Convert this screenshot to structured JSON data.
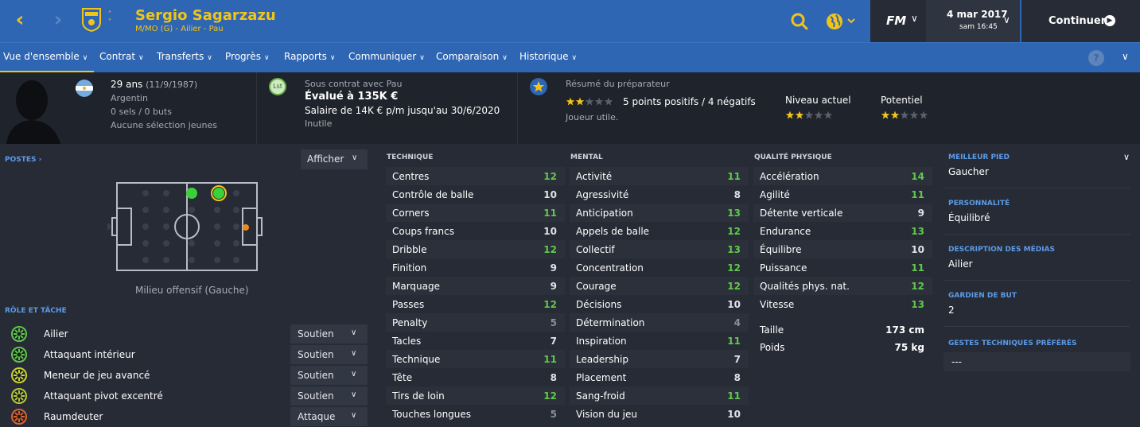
{
  "header": {
    "player_name": "Sergio Sagarzazu",
    "player_subtitle": "M/MO (G) - Ailier - Pau",
    "fm_logo": "FM",
    "date": "4 mar 2017",
    "time": "sam 16:45",
    "continue_label": "Continuer"
  },
  "nav": {
    "tabs": [
      {
        "label": "Vue d'ensemble"
      },
      {
        "label": "Contrat"
      },
      {
        "label": "Transferts"
      },
      {
        "label": "Progrès"
      },
      {
        "label": "Rapports"
      },
      {
        "label": "Communiquer"
      },
      {
        "label": "Comparaison"
      },
      {
        "label": "Historique"
      }
    ],
    "help_label": "?"
  },
  "info": {
    "age": "29 ans",
    "birth": "(11/9/1987)",
    "nationality": "Argentin",
    "caps": "0 sels / 0 buts",
    "youth_caps": "Aucune sélection jeunes",
    "contract_badge": "Lst",
    "contract_with": "Sous contrat avec Pau",
    "value": "Évalué à 135K €",
    "wage": "Salaire de 14K € p/m jusqu'au 30/6/2020",
    "squad_status": "Inutile",
    "scout_title": "Résumé du préparateur",
    "scout_summary": "5 points positifs / 4 négatifs",
    "scout_note": "Joueur utile.",
    "scout_stars": 2,
    "current_label": "Niveau actuel",
    "current_stars": 2,
    "potential_label": "Potentiel",
    "potential_stars": 2,
    "star_total": 5
  },
  "colors": {
    "header_blue": "#2f66b3",
    "accent_yellow": "#f0c419",
    "attr_high": "#5fc94b",
    "label_blue": "#5d9be8"
  },
  "positions": {
    "title": "POSTES",
    "show_label": "Afficher",
    "caption": "Milieu offensif (Gauche)"
  },
  "roles": {
    "title": "RÔLE ET TÂCHE",
    "items": [
      {
        "name": "Ailier",
        "duty": "Soutien",
        "color": "#5fc94b"
      },
      {
        "name": "Attaquant intérieur",
        "duty": "Soutien",
        "color": "#5fc94b"
      },
      {
        "name": "Meneur de jeu avancé",
        "duty": "Soutien",
        "color": "#c9d42d"
      },
      {
        "name": "Attaquant pivot excentré",
        "duty": "Soutien",
        "color": "#b7c93a"
      },
      {
        "name": "Raumdeuter",
        "duty": "Attaque",
        "color": "#e0632d"
      }
    ]
  },
  "attributes": {
    "technical": {
      "title": "TECHNIQUE",
      "items": [
        {
          "name": "Centres",
          "value": "12"
        },
        {
          "name": "Contrôle de balle",
          "value": "10"
        },
        {
          "name": "Corners",
          "value": "11"
        },
        {
          "name": "Coups francs",
          "value": "10"
        },
        {
          "name": "Dribble",
          "value": "12"
        },
        {
          "name": "Finition",
          "value": "9"
        },
        {
          "name": "Marquage",
          "value": "9"
        },
        {
          "name": "Passes",
          "value": "12"
        },
        {
          "name": "Penalty",
          "value": "5"
        },
        {
          "name": "Tacles",
          "value": "7"
        },
        {
          "name": "Technique",
          "value": "11"
        },
        {
          "name": "Tête",
          "value": "8"
        },
        {
          "name": "Tirs de loin",
          "value": "12"
        },
        {
          "name": "Touches longues",
          "value": "5"
        }
      ]
    },
    "mental": {
      "title": "MENTAL",
      "items": [
        {
          "name": "Activité",
          "value": "11"
        },
        {
          "name": "Agressivité",
          "value": "8"
        },
        {
          "name": "Anticipation",
          "value": "13"
        },
        {
          "name": "Appels de balle",
          "value": "12"
        },
        {
          "name": "Collectif",
          "value": "13"
        },
        {
          "name": "Concentration",
          "value": "12"
        },
        {
          "name": "Courage",
          "value": "12"
        },
        {
          "name": "Décisions",
          "value": "10"
        },
        {
          "name": "Détermination",
          "value": "4"
        },
        {
          "name": "Inspiration",
          "value": "11"
        },
        {
          "name": "Leadership",
          "value": "7"
        },
        {
          "name": "Placement",
          "value": "8"
        },
        {
          "name": "Sang-froid",
          "value": "11"
        },
        {
          "name": "Vision du jeu",
          "value": "10"
        }
      ]
    },
    "physical": {
      "title": "QUALITÉ PHYSIQUE",
      "items": [
        {
          "name": "Accélération",
          "value": "14"
        },
        {
          "name": "Agilité",
          "value": "11"
        },
        {
          "name": "Détente verticale",
          "value": "9"
        },
        {
          "name": "Endurance",
          "value": "13"
        },
        {
          "name": "Équilibre",
          "value": "10"
        },
        {
          "name": "Puissance",
          "value": "11"
        },
        {
          "name": "Qualités phys. nat.",
          "value": "12"
        },
        {
          "name": "Vitesse",
          "value": "13"
        }
      ],
      "extra": [
        {
          "name": "Taille",
          "value": "173 cm"
        },
        {
          "name": "Poids",
          "value": "75 kg"
        }
      ]
    }
  },
  "side": {
    "best_foot_label": "MEILLEUR PIED",
    "best_foot": "Gaucher",
    "personality_label": "PERSONNALITÉ",
    "personality": "Équilibré",
    "media_label": "DESCRIPTION DES MÉDIAS",
    "media": "Ailier",
    "keeper_label": "GARDIEN DE BUT",
    "keeper": "2",
    "moves_label": "GESTES TECHNIQUES PRÉFÉRÉS",
    "moves": "---"
  }
}
